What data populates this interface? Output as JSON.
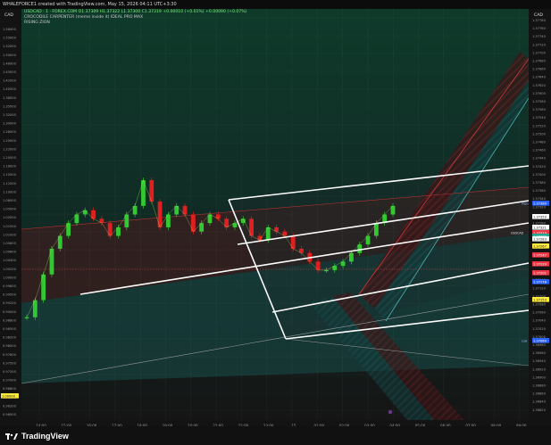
{
  "header": {
    "caption": "WHALEFORCE1 created with TradingView.com, May 15, 2026 04:11 UTC+3:30"
  },
  "legend": {
    "symbol_line": "USDCAD · 1 · FOREX.COM  O1.37309 H1.37322 L1.37300 C1.37319 +0.00010 (+0.01%) +0.00090 (+0.07%)",
    "indicator_line": "CROCODILE CARPENTER (meme inside it) IDEAL PRO MAX",
    "sub_line": "RISING ZION"
  },
  "axes": {
    "left_currency": "CAD",
    "right_currency": "CAD",
    "left_ticks": [
      "1.58000",
      "1.55000",
      "1.52000",
      "1.50000",
      "1.48000",
      "1.45000",
      "1.42000",
      "1.40000",
      "1.38000",
      "1.35000",
      "1.32000",
      "1.30000",
      "1.28000",
      "1.25000",
      "1.22000",
      "1.20000",
      "1.18000",
      "1.15000",
      "1.12000",
      "1.10000",
      "1.08000",
      "1.05000",
      "1.02000",
      "1.01500",
      "1.01000",
      "1.00800",
      "1.00600",
      "1.00400",
      "1.00200",
      "1.00000",
      "0.99800",
      "0.99500",
      "0.99200",
      "0.99000",
      "0.98800",
      "0.98500",
      "0.98200",
      "0.98000",
      "0.97800",
      "0.97500",
      "0.97200",
      "0.97000",
      "0.96800",
      "0.96500",
      "0.96200",
      "0.96000"
    ],
    "right_ticks": [
      "1.37780",
      "1.37760",
      "1.37740",
      "1.37720",
      "1.37700",
      "1.37680",
      "1.37660",
      "1.37640",
      "1.37620",
      "1.37600",
      "1.37580",
      "1.37560",
      "1.37540",
      "1.37520",
      "1.37500",
      "1.37480",
      "1.37460",
      "1.37440",
      "1.37420",
      "1.37400",
      "1.37380",
      "1.37360",
      "1.37340",
      "1.37320",
      "1.37300",
      "1.37280",
      "1.37260",
      "1.37240",
      "1.37220",
      "1.37200",
      "1.37180",
      "1.37160",
      "1.37140",
      "1.37120",
      "1.37100",
      "1.37080",
      "1.37060",
      "1.37040",
      "1.37020",
      "1.37000",
      "1.36980",
      "1.36960",
      "1.36940",
      "1.36920",
      "1.36900",
      "1.36880",
      "1.36860",
      "1.36840",
      "1.36820"
    ],
    "x_ticks": [
      "14:00",
      "15:00",
      "16:00",
      "17:00",
      "18:00",
      "19:00",
      "20:00",
      "21:00",
      "22:00",
      "23:00",
      "15",
      "01:00",
      "02:00",
      "03:00",
      "04:00",
      "05:00",
      "06:00",
      "07:00",
      "08:00",
      "09:00"
    ]
  },
  "price_labels": [
    {
      "text": "High",
      "value": "1.37380",
      "color": "#2962ff"
    },
    {
      "text": "",
      "value": "1.37359",
      "color": "#ffffff"
    },
    {
      "text": "",
      "value": "1.37321",
      "color": "#ffffff"
    },
    {
      "text": "USDCAD",
      "value": "1.37319",
      "color": "#f23645"
    },
    {
      "text": "",
      "value": "1.37309",
      "color": "#22ab94"
    },
    {
      "text": "",
      "value": "1.37283",
      "color": "#ffffff"
    },
    {
      "text": "",
      "value": "1.37267",
      "color": "#ffeb3b"
    },
    {
      "text": "",
      "value": "1.37247",
      "color": "#f23645"
    },
    {
      "text": "",
      "value": "1.37229",
      "color": "#f23645"
    },
    {
      "text": "",
      "value": "1.37201",
      "color": "#f23645"
    },
    {
      "text": "",
      "value": "1.37178",
      "color": "#2962ff"
    },
    {
      "text": "",
      "value": "1.37153",
      "color": "#ffeb3b"
    },
    {
      "text": "Low",
      "value": "1.37064",
      "color": "#2962ff"
    }
  ],
  "left_badges": [
    {
      "value": "1.00000",
      "color": "#ffeb3b"
    }
  ],
  "brand": {
    "name": "TradingView"
  },
  "chart_data": {
    "type": "line",
    "title": "USDCAD · 1 · FOREX.COM",
    "xlabel": "",
    "ylabel": "",
    "ylim": [
      1.3682,
      1.3778
    ],
    "x": [
      "13:30",
      "13:50",
      "14:10",
      "14:30",
      "14:50",
      "15:10",
      "15:30",
      "15:50",
      "16:10",
      "16:30",
      "16:50",
      "17:10",
      "17:30",
      "17:50",
      "18:10",
      "18:30",
      "18:50",
      "19:10",
      "19:30",
      "19:50",
      "20:10",
      "20:30",
      "20:50",
      "21:10",
      "21:30",
      "21:50",
      "22:10",
      "22:30",
      "22:50",
      "23:10",
      "23:30",
      "23:50",
      "00:10",
      "00:30",
      "00:50",
      "01:10",
      "01:30",
      "01:50",
      "02:10",
      "02:30",
      "02:50",
      "03:10",
      "03:30",
      "03:50",
      "04:10"
    ],
    "series": [
      {
        "name": "USDCAD",
        "values": [
          1.3706,
          1.371,
          1.3716,
          1.3722,
          1.3725,
          1.3728,
          1.373,
          1.3731,
          1.3729,
          1.3728,
          1.3725,
          1.3727,
          1.373,
          1.3732,
          1.3738,
          1.3733,
          1.3727,
          1.373,
          1.3732,
          1.373,
          1.3726,
          1.3728,
          1.373,
          1.3729,
          1.3727,
          1.3728,
          1.3729,
          1.3725,
          1.3724,
          1.3727,
          1.3726,
          1.3725,
          1.3722,
          1.3721,
          1.3719,
          1.3717,
          1.3717,
          1.3718,
          1.3719,
          1.3721,
          1.3723,
          1.3725,
          1.3728,
          1.373,
          1.3732
        ]
      }
    ],
    "channels": [
      {
        "name": "",
        "color": "#ffffff"
      }
    ]
  }
}
